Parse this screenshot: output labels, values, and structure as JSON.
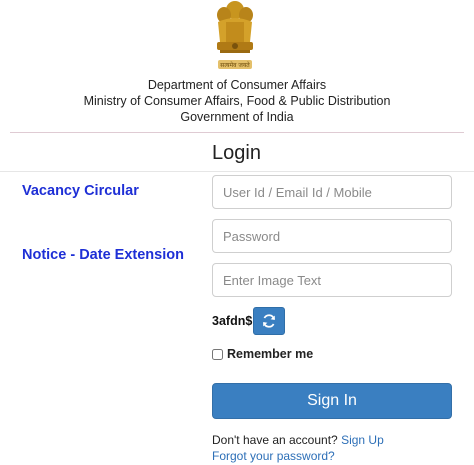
{
  "header": {
    "emblem_motto": "सत्यमेव जयते",
    "line1": "Department of Consumer Affairs",
    "line2": "Ministry of Consumer Affairs, Food & Public Distribution",
    "line3": "Government of India"
  },
  "login": {
    "title": "Login",
    "username_placeholder": "User Id / Email Id / Mobile",
    "password_placeholder": "Password",
    "image_text_placeholder": "Enter Image Text",
    "captcha": "3afdn$",
    "remember_label": "Remember me",
    "signin_label": "Sign In",
    "no_account_text": "Don't have an account?",
    "signup_link": "Sign Up",
    "forgot_link": "Forgot your password?"
  },
  "links": {
    "vacancy": "Vacancy Circular",
    "notice": "Notice - Date Extension"
  },
  "colors": {
    "accent": "#3a7fc1",
    "left_link": "#1e2fd6",
    "link": "#2d6fb7"
  },
  "icons": {
    "emblem": "national-emblem-icon",
    "refresh": "refresh-icon"
  }
}
